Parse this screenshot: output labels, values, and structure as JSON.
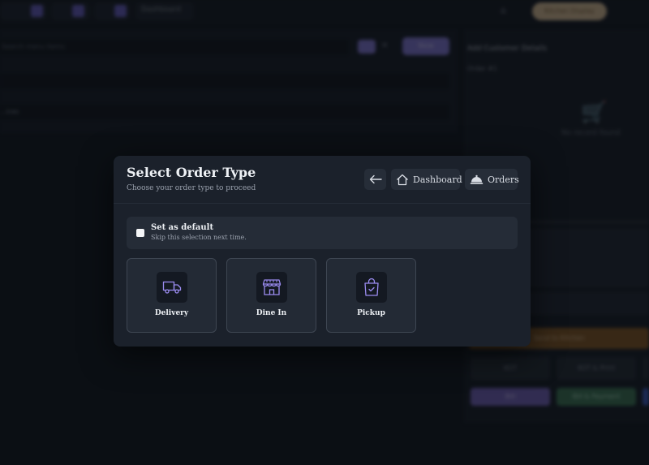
{
  "background": {
    "topbar": {
      "dashboard_label": "Dashboard",
      "gold_button_label": "Kitchen Display"
    },
    "left_panel": {
      "search_placeholder": "Search menu items",
      "new_button_label": "New",
      "select_value": "...ices"
    },
    "right_panel": {
      "title": "Add Customer Details",
      "order_label": "Order #1",
      "empty_text": "No record found",
      "place_order_label": "Send to Kitchen",
      "buttons": [
        "KOT",
        "KOT & Print"
      ],
      "bottom_buttons": [
        "Bill",
        "Bill & Payment"
      ]
    }
  },
  "modal": {
    "title": "Select Order Type",
    "subtitle": "Choose your order type to proceed",
    "header_buttons": {
      "dashboard_label": "Dashboard",
      "orders_label": "Orders"
    },
    "default": {
      "label": "Set as default",
      "sublabel": "Skip this selection next time.",
      "checked": false
    },
    "order_types": [
      {
        "label": "Delivery",
        "icon": "truck-icon"
      },
      {
        "label": "Dine In",
        "icon": "storefront-icon"
      },
      {
        "label": "Pickup",
        "icon": "shopping-bag-icon"
      }
    ]
  },
  "colors": {
    "accent": "#8a7de0",
    "modal_bg": "#1b212b",
    "page_bg": "#0f131a"
  }
}
